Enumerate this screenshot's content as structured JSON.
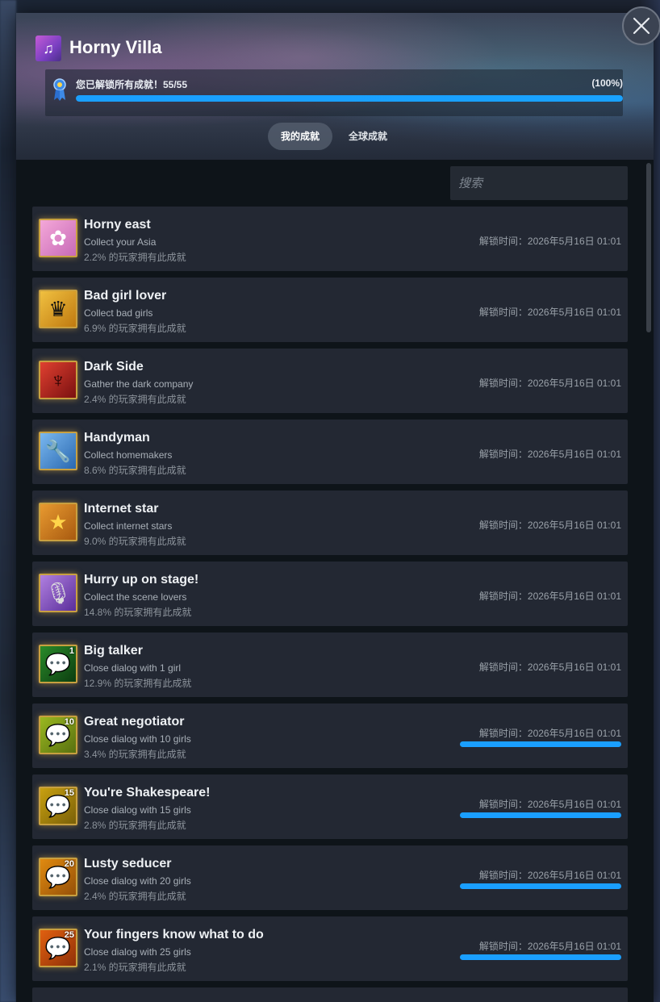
{
  "game": {
    "title": "Horny Villa",
    "icon": "music-note-icon"
  },
  "progress": {
    "label": "您已解锁所有成就！55/55",
    "percent_text": "(100%)",
    "percent": 100
  },
  "tabs": [
    {
      "label": "我的成就",
      "active": true
    },
    {
      "label": "全球成就",
      "active": false
    }
  ],
  "search": {
    "placeholder": "搜索"
  },
  "achievements": [
    {
      "name": "Horny east",
      "desc": "Collect your Asia",
      "pct": "2.2% 的玩家拥有此成就",
      "time": "解锁时间：2026年5月16日 01:01",
      "icon": "flower-icon",
      "bar": false
    },
    {
      "name": "Bad girl lover",
      "desc": "Collect bad girls",
      "pct": "6.9% 的玩家拥有此成就",
      "time": "解锁时间：2026年5月16日 01:01",
      "icon": "witch-icon",
      "bar": false
    },
    {
      "name": "Dark Side",
      "desc": "Gather the dark company",
      "pct": "2.4% 的玩家拥有此成就",
      "time": "解锁时间：2026年5月16日 01:01",
      "icon": "devil-icon",
      "bar": false
    },
    {
      "name": "Handyman",
      "desc": "Collect homemakers",
      "pct": "8.6% 的玩家拥有此成就",
      "time": "解锁时间：2026年5月16日 01:01",
      "icon": "wrench-icon",
      "bar": false
    },
    {
      "name": "Internet star",
      "desc": "Collect internet stars",
      "pct": "9.0% 的玩家拥有此成就",
      "time": "解锁时间：2026年5月16日 01:01",
      "icon": "star-icon",
      "bar": false
    },
    {
      "name": "Hurry up on stage!",
      "desc": "Collect the scene lovers",
      "pct": "14.8% 的玩家拥有此成就",
      "time": "解锁时间：2026年5月16日 01:01",
      "icon": "microphone-icon",
      "bar": false
    },
    {
      "name": "Big talker",
      "desc": "Close dialog with 1 girl",
      "pct": "12.9% 的玩家拥有此成就",
      "time": "解锁时间：2026年5月16日 01:01",
      "icon": "chat-bubble-icon",
      "badge": "1",
      "bar": false
    },
    {
      "name": "Great negotiator",
      "desc": "Close dialog with 10 girls",
      "pct": "3.4% 的玩家拥有此成就",
      "time": "解锁时间：2026年5月16日 01:01",
      "icon": "chat-bubble-icon",
      "badge": "10",
      "bar": true
    },
    {
      "name": "You're Shakespeare!",
      "desc": "Close dialog with 15 girls",
      "pct": "2.8% 的玩家拥有此成就",
      "time": "解锁时间：2026年5月16日 01:01",
      "icon": "chat-bubble-icon",
      "badge": "15",
      "bar": true
    },
    {
      "name": "Lusty seducer",
      "desc": "Close dialog with 20 girls",
      "pct": "2.4% 的玩家拥有此成就",
      "time": "解锁时间：2026年5月16日 01:01",
      "icon": "chat-bubble-icon",
      "badge": "20",
      "bar": true
    },
    {
      "name": "Your fingers know what to do",
      "desc": "Close dialog with 25 girls",
      "pct": "2.1% 的玩家拥有此成就",
      "time": "解锁时间：2026年5月16日 01:01",
      "icon": "chat-bubble-icon",
      "badge": "25",
      "bar": true
    }
  ]
}
